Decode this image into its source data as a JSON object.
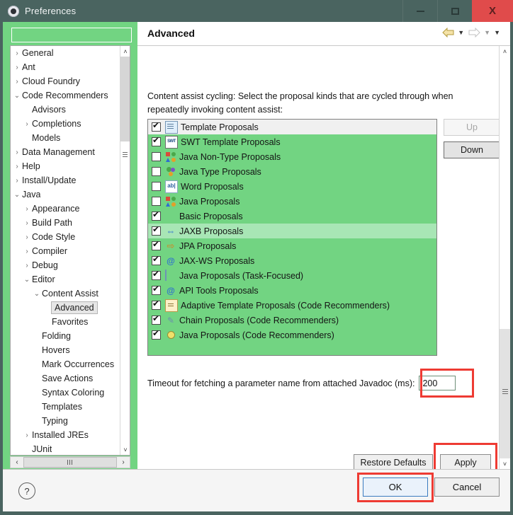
{
  "window": {
    "title": "Preferences",
    "icon": "gear-icon",
    "minimize_label": "",
    "maximize_label": "",
    "close_label": "X"
  },
  "sidebar": {
    "filter_value": "",
    "filter_placeholder": "",
    "items": [
      {
        "label": "General",
        "indent": 0,
        "twisty": "collapsed",
        "selected": false
      },
      {
        "label": "Ant",
        "indent": 0,
        "twisty": "collapsed",
        "selected": false
      },
      {
        "label": "Cloud Foundry",
        "indent": 0,
        "twisty": "collapsed",
        "selected": false
      },
      {
        "label": "Code Recommenders",
        "indent": 0,
        "twisty": "expanded",
        "selected": false
      },
      {
        "label": "Advisors",
        "indent": 1,
        "twisty": "none",
        "selected": false
      },
      {
        "label": "Completions",
        "indent": 1,
        "twisty": "collapsed",
        "selected": false
      },
      {
        "label": "Models",
        "indent": 1,
        "twisty": "none",
        "selected": false
      },
      {
        "label": "Data Management",
        "indent": 0,
        "twisty": "collapsed",
        "selected": false
      },
      {
        "label": "Help",
        "indent": 0,
        "twisty": "collapsed",
        "selected": false
      },
      {
        "label": "Install/Update",
        "indent": 0,
        "twisty": "collapsed",
        "selected": false
      },
      {
        "label": "Java",
        "indent": 0,
        "twisty": "expanded",
        "selected": false
      },
      {
        "label": "Appearance",
        "indent": 1,
        "twisty": "collapsed",
        "selected": false
      },
      {
        "label": "Build Path",
        "indent": 1,
        "twisty": "collapsed",
        "selected": false
      },
      {
        "label": "Code Style",
        "indent": 1,
        "twisty": "collapsed",
        "selected": false
      },
      {
        "label": "Compiler",
        "indent": 1,
        "twisty": "collapsed",
        "selected": false
      },
      {
        "label": "Debug",
        "indent": 1,
        "twisty": "collapsed",
        "selected": false
      },
      {
        "label": "Editor",
        "indent": 1,
        "twisty": "expanded",
        "selected": false
      },
      {
        "label": "Content Assist",
        "indent": 2,
        "twisty": "expanded",
        "selected": false
      },
      {
        "label": "Advanced",
        "indent": 3,
        "twisty": "none",
        "selected": true
      },
      {
        "label": "Favorites",
        "indent": 3,
        "twisty": "none",
        "selected": false
      },
      {
        "label": "Folding",
        "indent": 2,
        "twisty": "none",
        "selected": false
      },
      {
        "label": "Hovers",
        "indent": 2,
        "twisty": "none",
        "selected": false
      },
      {
        "label": "Mark Occurrences",
        "indent": 2,
        "twisty": "none",
        "selected": false
      },
      {
        "label": "Save Actions",
        "indent": 2,
        "twisty": "none",
        "selected": false
      },
      {
        "label": "Syntax Coloring",
        "indent": 2,
        "twisty": "none",
        "selected": false
      },
      {
        "label": "Templates",
        "indent": 2,
        "twisty": "none",
        "selected": false
      },
      {
        "label": "Typing",
        "indent": 2,
        "twisty": "none",
        "selected": false
      },
      {
        "label": "Installed JREs",
        "indent": 1,
        "twisty": "collapsed",
        "selected": false
      },
      {
        "label": "JUnit",
        "indent": 1,
        "twisty": "none",
        "selected": false
      }
    ]
  },
  "page": {
    "title": "Advanced",
    "description": "Content assist cycling: Select the proposal kinds that are cycled through when repeatedly invoking content assist:",
    "nav": {
      "back_icon": "back-arrow-icon",
      "back_menu_icon": "chevron-down-icon",
      "forward_icon": "forward-arrow-icon",
      "forward_menu_icon": "chevron-down-icon",
      "view_menu_icon": "chevron-down-icon"
    }
  },
  "proposal_list": {
    "rows": [
      {
        "label": "Template Proposals",
        "checked": true,
        "icon": "template-document-icon",
        "state": "selected"
      },
      {
        "label": "SWT Template Proposals",
        "checked": true,
        "icon": "swt-template-icon",
        "state": "normal"
      },
      {
        "label": "Java Non-Type Proposals",
        "checked": false,
        "icon": "java-shapes-icon",
        "state": "normal"
      },
      {
        "label": "Java Type Proposals",
        "checked": false,
        "icon": "java-type-circles-icon",
        "state": "normal"
      },
      {
        "label": "Word Proposals",
        "checked": false,
        "icon": "abc-word-icon",
        "state": "normal"
      },
      {
        "label": "Java Proposals",
        "checked": false,
        "icon": "java-shapes-icon",
        "state": "normal"
      },
      {
        "label": "Basic Proposals",
        "checked": true,
        "icon": "none",
        "state": "normal"
      },
      {
        "label": "JAXB Proposals",
        "checked": true,
        "icon": "jaxb-arrow-icon",
        "state": "highlight"
      },
      {
        "label": "JPA Proposals",
        "checked": true,
        "icon": "jpa-arrow-icon",
        "state": "normal"
      },
      {
        "label": "JAX-WS Proposals",
        "checked": true,
        "icon": "at-sign-icon",
        "state": "normal"
      },
      {
        "label": "Java Proposals (Task-Focused)",
        "checked": true,
        "icon": "task-focused-icon",
        "state": "normal"
      },
      {
        "label": "API Tools Proposals",
        "checked": true,
        "icon": "api-at-icon",
        "state": "normal"
      },
      {
        "label": "Adaptive Template Proposals (Code Recommenders)",
        "checked": true,
        "icon": "adaptive-template-icon",
        "state": "normal"
      },
      {
        "label": "Chain Proposals (Code Recommenders)",
        "checked": true,
        "icon": "chain-icon",
        "state": "normal"
      },
      {
        "label": "Java Proposals (Code Recommenders)",
        "checked": true,
        "icon": "bulb-icon",
        "state": "normal"
      }
    ]
  },
  "order_buttons": {
    "up_label": "Up",
    "up_enabled": false,
    "down_label": "Down",
    "down_enabled": true
  },
  "timeout": {
    "label": "Timeout for fetching a parameter name from attached Javadoc (ms):",
    "value": "200",
    "highlighted": true
  },
  "page_buttons": {
    "restore_defaults_label": "Restore Defaults",
    "apply_label": "Apply",
    "apply_highlighted": true
  },
  "footer": {
    "help_icon": "question-mark-icon",
    "ok_label": "OK",
    "ok_highlighted": true,
    "cancel_label": "Cancel"
  },
  "colors": {
    "window_chrome": "#4a6460",
    "accent_green": "#72d482",
    "highlight_red": "#ee3b33",
    "close_red": "#e04b4b",
    "focus_blue": "#3a7cbf"
  },
  "scrollbars": {
    "tree_up_arrow": "˄",
    "tree_down_arrow": "˅",
    "left_arrow": "‹",
    "right_arrow": "›"
  }
}
